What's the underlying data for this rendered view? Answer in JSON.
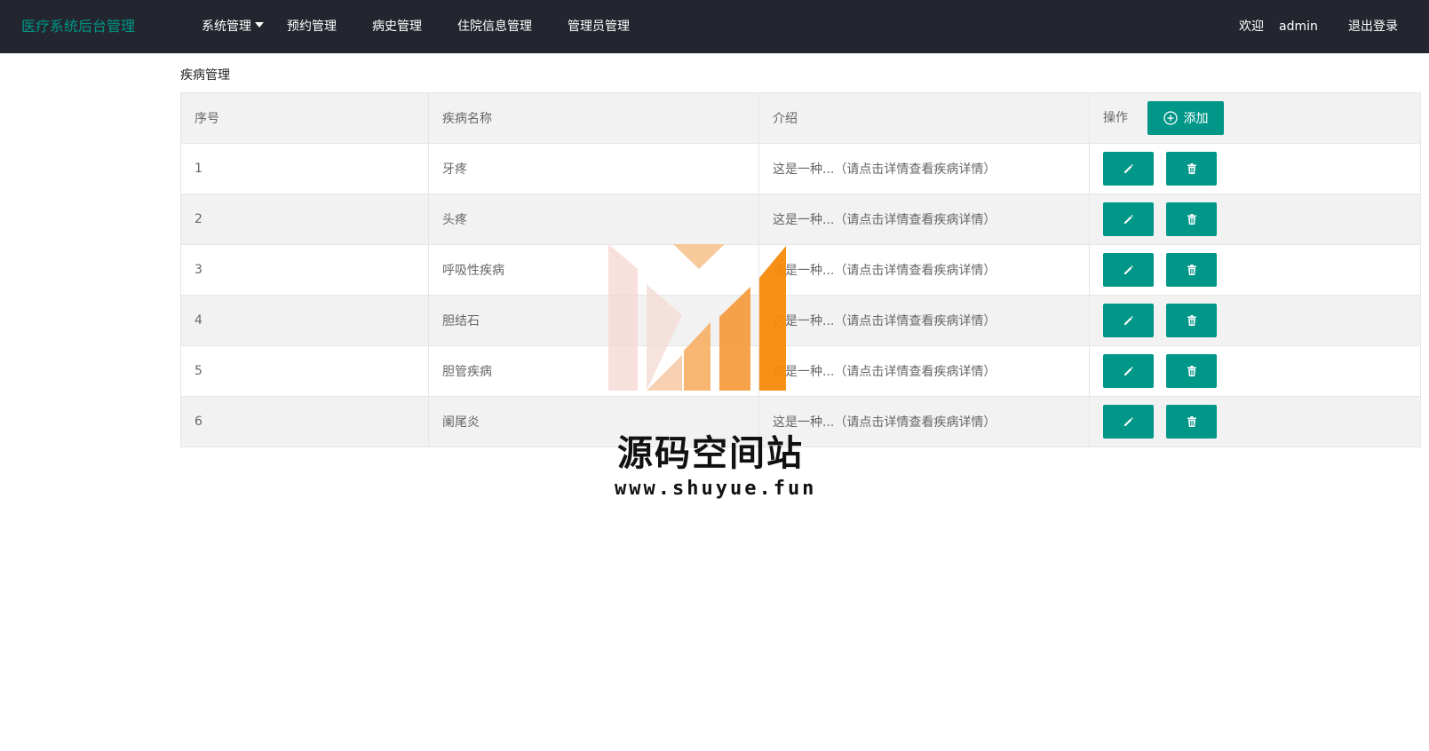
{
  "header": {
    "logo": "医疗系统后台管理",
    "nav": [
      {
        "label": "系统管理",
        "has_dropdown": true
      },
      {
        "label": "预约管理"
      },
      {
        "label": "病史管理"
      },
      {
        "label": "住院信息管理"
      },
      {
        "label": "管理员管理"
      }
    ],
    "welcome_label": "欢迎",
    "username": "admin",
    "logout_label": "退出登录"
  },
  "page": {
    "title": "疾病管理"
  },
  "table": {
    "columns": [
      "序号",
      "疾病名称",
      "介绍",
      "操作"
    ],
    "add_button_label": "添加",
    "rows": [
      {
        "id": "1",
        "name": "牙疼",
        "intro": "这是一种...（请点击详情查看疾病详情）"
      },
      {
        "id": "2",
        "name": "头疼",
        "intro": "这是一种...（请点击详情查看疾病详情）"
      },
      {
        "id": "3",
        "name": "呼吸性疾病",
        "intro": "这是一种...（请点击详情查看疾病详情）"
      },
      {
        "id": "4",
        "name": "胆结石",
        "intro": "这是一种...（请点击详情查看疾病详情）"
      },
      {
        "id": "5",
        "name": "胆管疾病",
        "intro": "这是一种...（请点击详情查看疾病详情）"
      },
      {
        "id": "6",
        "name": "阑尾炎",
        "intro": "这是一种...（请点击详情查看疾病详情）"
      }
    ]
  },
  "watermark": {
    "title": "源码空间站",
    "url": "www.shuyue.fun"
  },
  "colors": {
    "header_bg": "#23262e",
    "accent": "#009688",
    "watermark_orange": "#f58a0a"
  },
  "icons": {
    "edit": "pencil-icon",
    "delete": "trash-icon",
    "add": "plus-circle-icon",
    "dropdown": "caret-down-icon"
  }
}
